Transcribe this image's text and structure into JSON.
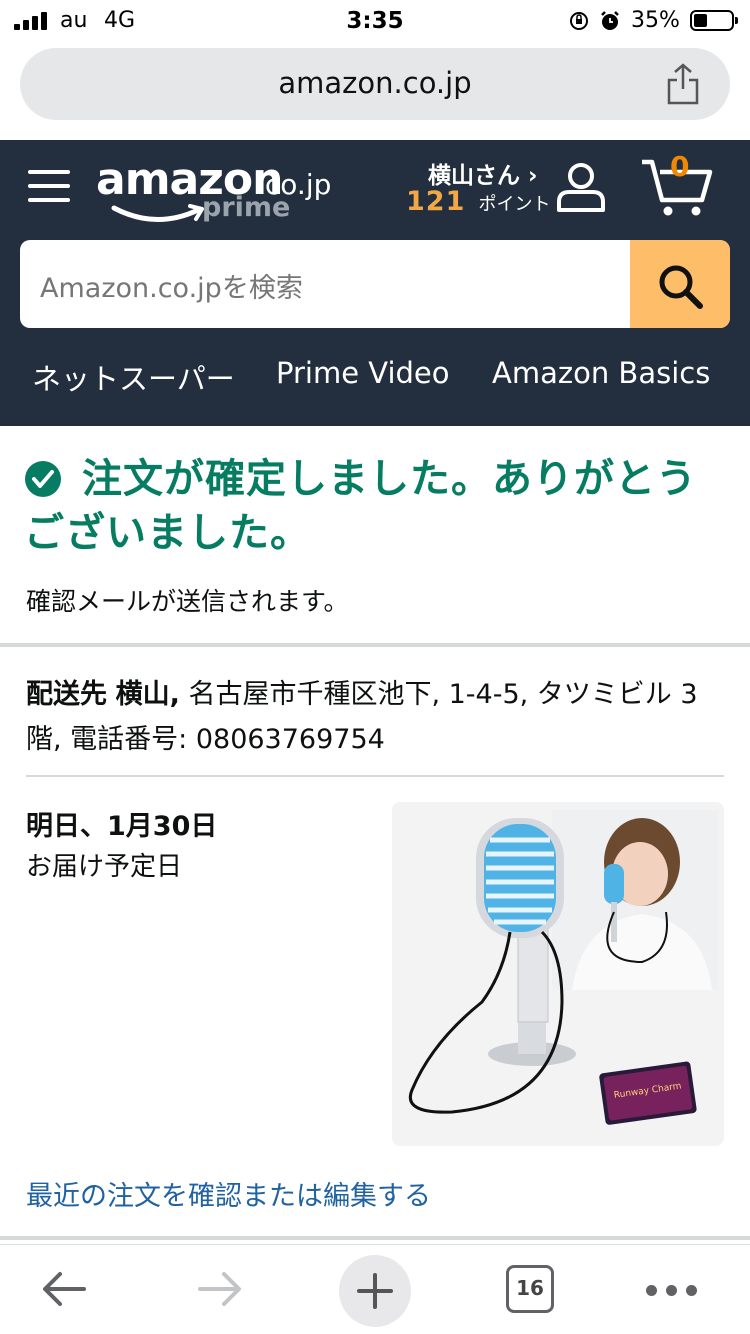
{
  "status_bar": {
    "carrier": "au",
    "network": "4G",
    "time": "3:35",
    "battery": "35%",
    "battery_level": 0.35
  },
  "browser": {
    "url": "amazon.co.jp",
    "tab_count": "16"
  },
  "header": {
    "logo": {
      "word": "amazon",
      "tld": ".co.jp",
      "sub": "prime"
    },
    "user_name": "横山さん ›",
    "points_value": "121",
    "points_label": "ポイント",
    "cart_count": "0",
    "search_placeholder": "Amazon.co.jpを検索",
    "nav": [
      "ネットスーパー",
      "Prime Video",
      "Amazon Basics"
    ]
  },
  "confirmation": {
    "title": "注文が確定しました。ありがとうございました。",
    "subtitle": "確認メールが送信されます。"
  },
  "shipping": {
    "label": "配送先",
    "name": "横山,",
    "address": "名古屋市千種区池下, 1-4-5, タツミビル 3階, 電話番号: 08063769754"
  },
  "delivery": {
    "date": "明日、1月30日",
    "label": "お届け予定日"
  },
  "product": {
    "image": "blue-retro-microphone-product-image",
    "card_text": "Runway Charm"
  },
  "links": {
    "edit_order": "最近の注文を確認または編集する"
  },
  "colors": {
    "header_bg": "#232f3e",
    "accent_orange": "#febd69",
    "success_green": "#067d62",
    "link_blue": "#2162a1"
  }
}
